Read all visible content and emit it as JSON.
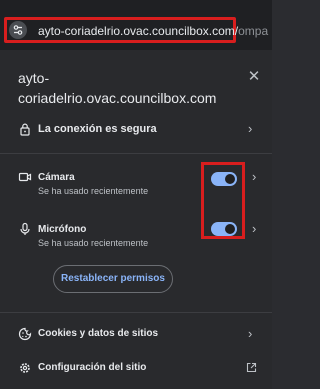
{
  "address_bar": {
    "url": "ayto-coriadelrio.ovac.councilbox.com/",
    "url_overflow": "ompa"
  },
  "popup": {
    "title": "ayto-coriadelrio.ovac.councilbox.com",
    "connection": {
      "label": "La conexión es segura"
    },
    "camera": {
      "label": "Cámara",
      "sublabel": "Se ha usado recientemente",
      "enabled": true
    },
    "microphone": {
      "label": "Micrófono",
      "sublabel": "Se ha usado recientemente",
      "enabled": true
    },
    "reset_button_label": "Restablecer permisos",
    "cookies": {
      "label": "Cookies y datos de sitios"
    },
    "site_settings": {
      "label": "Configuración del sitio"
    }
  },
  "colors": {
    "highlight": "#d81e1e",
    "toggle_on": "#8ab4f8",
    "background": "#292a2d"
  }
}
